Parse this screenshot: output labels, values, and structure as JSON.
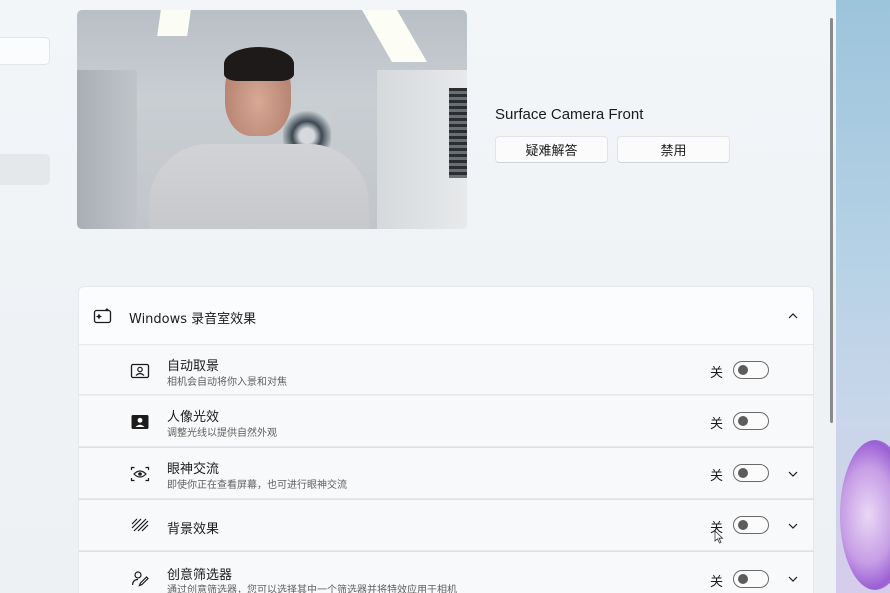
{
  "camera": {
    "name": "Surface Camera Front",
    "troubleshoot_label": "疑难解答",
    "disable_label": "禁用"
  },
  "studio_effects": {
    "title": "Windows 录音室效果",
    "icon": "sparkle-frame-icon",
    "items": [
      {
        "title": "自动取景",
        "subtitle": "相机会自动将你入景和对焦",
        "state": "关",
        "icon": "auto-framing-icon",
        "expandable": false
      },
      {
        "title": "人像光效",
        "subtitle": "调整光线以提供自然外观",
        "state": "关",
        "icon": "portrait-light-icon",
        "expandable": false
      },
      {
        "title": "眼神交流",
        "subtitle": "即使你正在查看屏幕，也可进行眼神交流",
        "state": "关",
        "icon": "eye-contact-icon",
        "expandable": true
      },
      {
        "title": "背景效果",
        "subtitle": "",
        "state": "关",
        "icon": "background-effects-icon",
        "expandable": true
      },
      {
        "title": "创意筛选器",
        "subtitle": "通过创意筛选器，您可以选择其中一个筛选器并将特效应用于相机",
        "state": "关",
        "icon": "creative-filter-icon",
        "expandable": true
      }
    ]
  }
}
